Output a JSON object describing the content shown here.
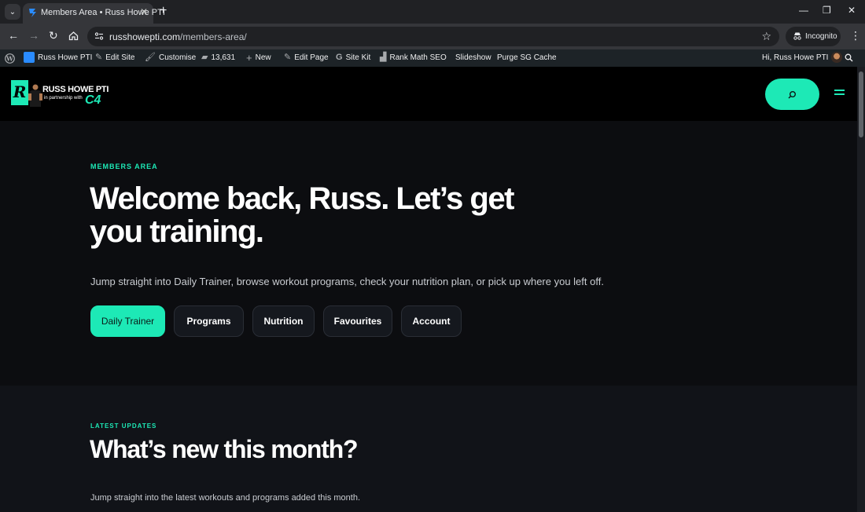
{
  "browser": {
    "tab_title": "Members Area • Russ Howe PTI",
    "tab_close": "✕",
    "new_tab": "+",
    "url_host": "russhowepti.com",
    "url_path": "/members-area/",
    "incognito_label": "Incognito",
    "window_controls": [
      "—",
      "❐",
      "✕"
    ]
  },
  "adminbar": {
    "site_name": "Russ Howe PTI",
    "edit_site": "Edit Site",
    "customise": "Customise",
    "comments_count": "13,631",
    "new": "New",
    "edit_page": "Edit Page",
    "site_kit": "Site Kit",
    "rank_math": "Rank Math SEO",
    "slideshow": "Slideshow",
    "purge_cache": "Purge SG Cache",
    "greeting": "Hi, Russ Howe PTI"
  },
  "logo": {
    "badge": "R",
    "name": "RUSS HOWE PTI",
    "partner": "in partnership with",
    "partner_brand": "C4"
  },
  "hero": {
    "eyebrow": "MEMBERS AREA",
    "title": "Welcome back, Russ. Let’s get you training.",
    "description": "Jump straight into Daily Trainer, browse workout programs, check your nutrition plan, or pick up where you left off.",
    "buttons": [
      "Daily Trainer",
      "Programs",
      "Nutrition",
      "Favourites",
      "Account"
    ]
  },
  "updates": {
    "eyebrow": "LATEST UPDATES",
    "title": "What’s new this month?",
    "description": "Jump straight into the latest workouts and programs added this month."
  },
  "icons": {
    "tab_favicon": "r-logo-icon",
    "accent": "#1de9b6"
  }
}
